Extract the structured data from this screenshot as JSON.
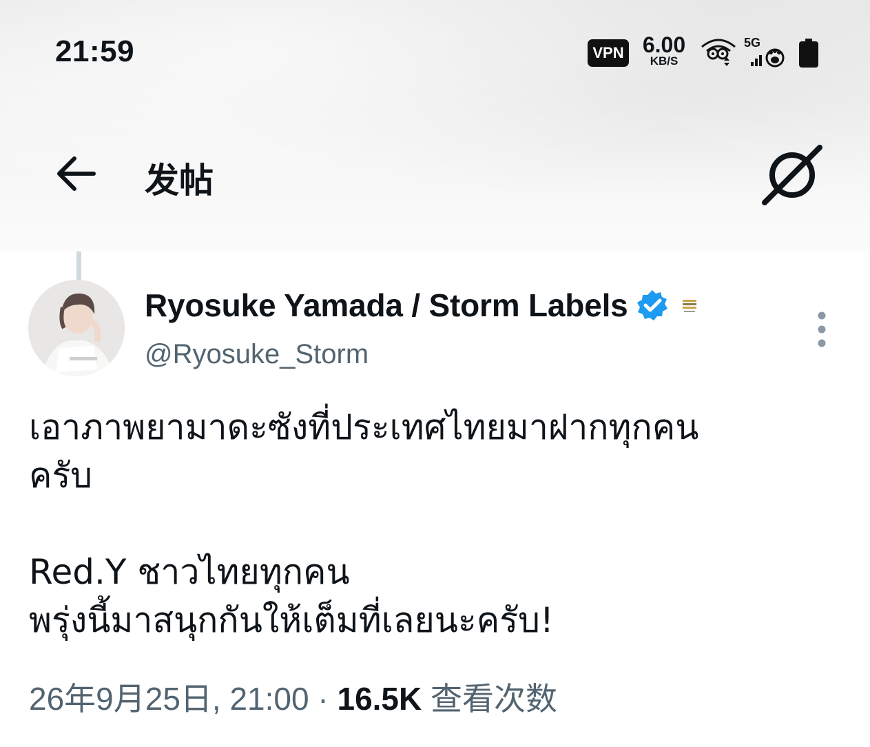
{
  "status_bar": {
    "time": "21:59",
    "vpn_label": "VPN",
    "net_speed": "6.00",
    "net_speed_unit": "KB/S",
    "network_type": "5G",
    "wifi": "wifi-icon",
    "signal": "signal-icon",
    "battery": "battery-full-icon"
  },
  "header": {
    "title": "发帖",
    "back": "back-arrow-icon",
    "grok": "grok-icon"
  },
  "tweet": {
    "display_name": "Ryosuke Yamada / Storm Labels",
    "handle": "@Ryosuke_Storm",
    "verified_color": "#1d9bf0",
    "text_lines_1": "เอาภาพยามาดะซังที่ประเทศไทยมาฝากทุกคน\nครับ",
    "text_lines_2": "Red.Y ชาวไทยทุกคน\nพรุ่งนี้มาสนุกกันให้เต็มที่เลยนะครับ!",
    "timestamp": "26年9月25日, 21:00",
    "separator": " · ",
    "views_count": "16.5K",
    "views_label": " 查看次数"
  },
  "colors": {
    "text_primary": "#0f1419",
    "text_secondary": "#536471",
    "thread_line": "#cfd9de"
  }
}
